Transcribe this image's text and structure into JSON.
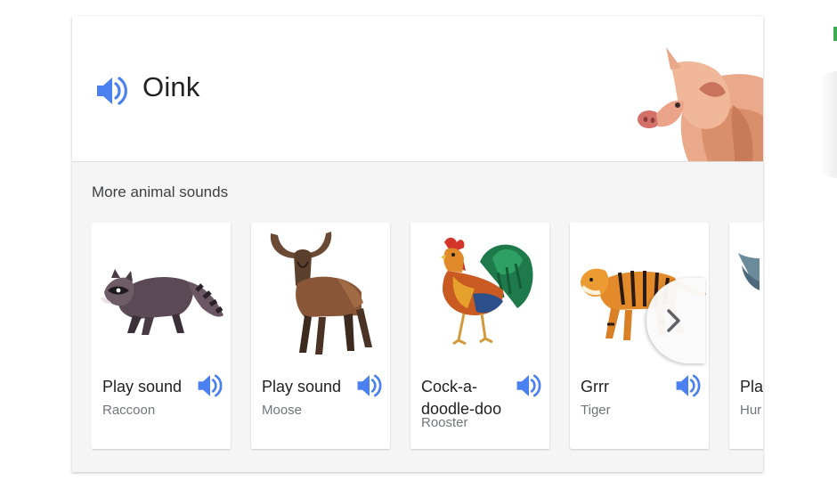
{
  "header": {
    "sound_text": "Oink",
    "speaker_icon": "speaker-icon",
    "illustration": "pig"
  },
  "more_sounds": {
    "title": "More animal sounds",
    "items": [
      {
        "sound": "Play sound",
        "animal": "Raccoon",
        "icon": "speaker-icon"
      },
      {
        "sound": "Play sound",
        "animal": "Moose",
        "icon": "speaker-icon"
      },
      {
        "sound": "Cock-a-doodle-doo",
        "animal": "Rooster",
        "icon": "speaker-icon"
      },
      {
        "sound": "Grrr",
        "animal": "Tiger",
        "icon": "speaker-icon"
      },
      {
        "sound": "Pla",
        "animal": "Hur",
        "icon": "speaker-icon"
      }
    ]
  },
  "carousel": {
    "next_icon": "chevron-right-icon"
  },
  "colors": {
    "speaker_blue": "#4a80f0",
    "title_text": "#202124",
    "secondary_text": "#70757a",
    "card_background": "#f5f5f5"
  }
}
